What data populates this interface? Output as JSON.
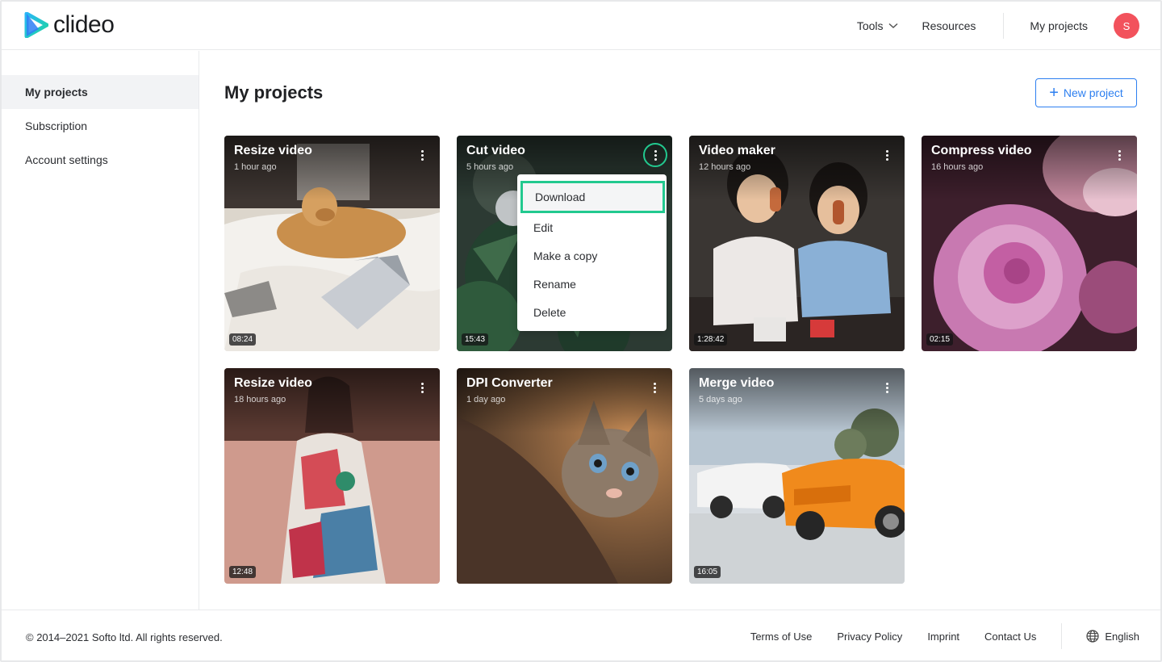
{
  "header": {
    "logo_text": "clideo",
    "nav": {
      "tools": "Tools",
      "resources": "Resources",
      "my_projects": "My projects"
    },
    "avatar_initial": "S"
  },
  "sidebar": {
    "items": [
      {
        "label": "My projects",
        "active": true
      },
      {
        "label": "Subscription",
        "active": false
      },
      {
        "label": "Account settings",
        "active": false
      }
    ]
  },
  "main": {
    "title": "My projects",
    "new_project_label": "New project"
  },
  "projects": [
    {
      "title": "Resize video",
      "time": "1 hour ago",
      "duration": "08:24",
      "image": "dog on bed with laptop"
    },
    {
      "title": "Cut video",
      "time": "5 hours ago",
      "duration": "15:43",
      "image": "christmas tree"
    },
    {
      "title": "Video maker",
      "time": "12 hours ago",
      "duration": "1:28:42",
      "image": "children with ice cream"
    },
    {
      "title": "Compress video",
      "time": "16 hours ago",
      "duration": "02:15",
      "image": "pink flower"
    },
    {
      "title": "Resize video",
      "time": "18 hours ago",
      "duration": "12:48",
      "image": "woman in floral dress"
    },
    {
      "title": "DPI Converter",
      "time": "1 day ago",
      "duration": "",
      "image": "cat"
    },
    {
      "title": "Merge video",
      "time": "5 days ago",
      "duration": "16:05",
      "image": "sports cars"
    }
  ],
  "context_menu": {
    "items": [
      "Download",
      "Edit",
      "Make a copy",
      "Rename",
      "Delete"
    ],
    "selected": "Download"
  },
  "footer": {
    "copyright": "© 2014–2021 Softo ltd. All rights reserved.",
    "links": [
      "Terms of Use",
      "Privacy Policy",
      "Imprint",
      "Contact Us"
    ],
    "language": "English"
  },
  "colors": {
    "brand_blue": "#2d7ff0",
    "highlight_green": "#22c98f",
    "avatar_red": "#f2525c"
  }
}
